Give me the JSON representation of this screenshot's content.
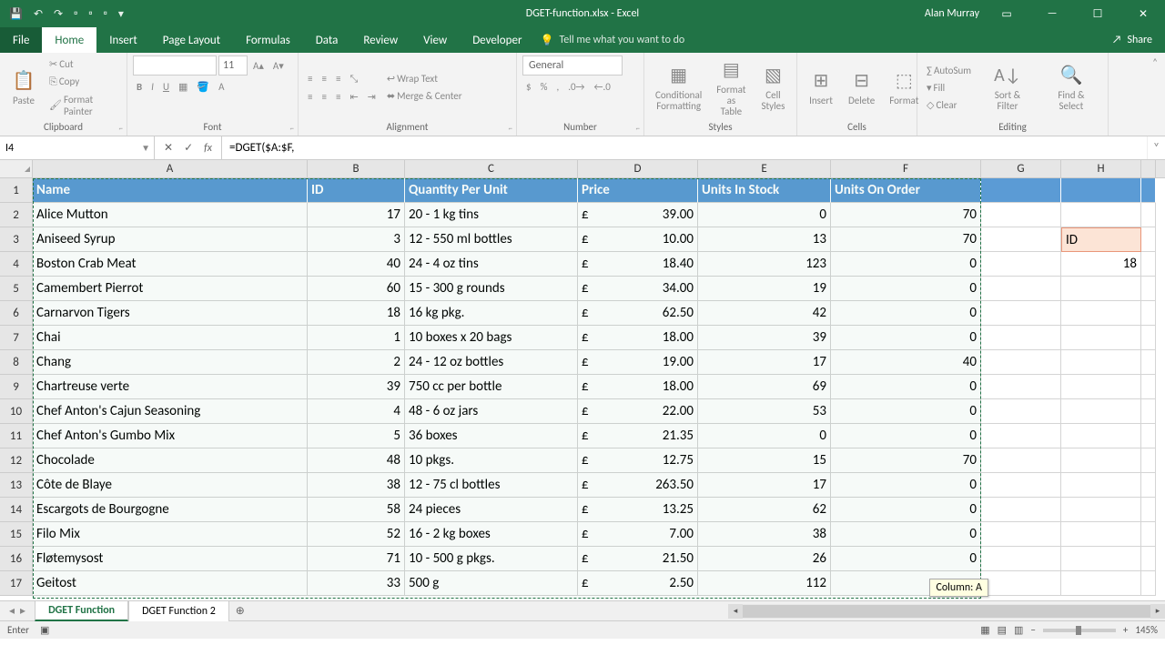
{
  "title": "DGET-function.xlsx - Excel",
  "user": "Alan Murray",
  "tabs": [
    "File",
    "Home",
    "Insert",
    "Page Layout",
    "Formulas",
    "Data",
    "Review",
    "View",
    "Developer"
  ],
  "active_tab": "Home",
  "tell_me": "Tell me what you want to do",
  "share": "Share",
  "ribbon": {
    "clipboard": {
      "label": "Clipboard",
      "paste": "Paste",
      "cut": "Cut",
      "copy": "Copy",
      "painter": "Format Painter"
    },
    "font": {
      "label": "Font",
      "size": "11"
    },
    "alignment": {
      "label": "Alignment",
      "wrap": "Wrap Text",
      "merge": "Merge & Center"
    },
    "number": {
      "label": "Number",
      "format": "General"
    },
    "styles": {
      "label": "Styles",
      "cond": "Conditional Formatting",
      "table": "Format as Table",
      "cell": "Cell Styles"
    },
    "cells": {
      "label": "Cells",
      "insert": "Insert",
      "delete": "Delete",
      "format": "Format"
    },
    "editing": {
      "label": "Editing",
      "sum": "AutoSum",
      "fill": "Fill",
      "clear": "Clear",
      "sort": "Sort & Filter",
      "find": "Find & Select"
    }
  },
  "name_box": "I4",
  "formula": "=DGET($A:$F,",
  "columns": [
    "A",
    "B",
    "C",
    "D",
    "E",
    "F",
    "G",
    "H"
  ],
  "headers": [
    "Name",
    "ID",
    "Quantity Per Unit",
    "Price",
    "Units In Stock",
    "Units On Order"
  ],
  "rows": [
    {
      "n": "Alice Mutton",
      "id": 17,
      "q": "20 - 1 kg tins",
      "p": "39.00",
      "s": 0,
      "o": 70
    },
    {
      "n": "Aniseed Syrup",
      "id": 3,
      "q": "12 - 550 ml bottles",
      "p": "10.00",
      "s": 13,
      "o": 70
    },
    {
      "n": "Boston Crab Meat",
      "id": 40,
      "q": "24 - 4 oz tins",
      "p": "18.40",
      "s": 123,
      "o": 0
    },
    {
      "n": "Camembert Pierrot",
      "id": 60,
      "q": "15 - 300 g rounds",
      "p": "34.00",
      "s": 19,
      "o": 0
    },
    {
      "n": "Carnarvon Tigers",
      "id": 18,
      "q": "16 kg pkg.",
      "p": "62.50",
      "s": 42,
      "o": 0
    },
    {
      "n": "Chai",
      "id": 1,
      "q": "10 boxes x 20 bags",
      "p": "18.00",
      "s": 39,
      "o": 0
    },
    {
      "n": "Chang",
      "id": 2,
      "q": "24 - 12 oz bottles",
      "p": "19.00",
      "s": 17,
      "o": 40
    },
    {
      "n": "Chartreuse verte",
      "id": 39,
      "q": "750 cc per bottle",
      "p": "18.00",
      "s": 69,
      "o": 0
    },
    {
      "n": "Chef Anton's Cajun Seasoning",
      "id": 4,
      "q": "48 - 6 oz jars",
      "p": "22.00",
      "s": 53,
      "o": 0
    },
    {
      "n": "Chef Anton's Gumbo Mix",
      "id": 5,
      "q": "36 boxes",
      "p": "21.35",
      "s": 0,
      "o": 0
    },
    {
      "n": "Chocolade",
      "id": 48,
      "q": "10 pkgs.",
      "p": "12.75",
      "s": 15,
      "o": 70
    },
    {
      "n": "Côte de Blaye",
      "id": 38,
      "q": "12 - 75 cl bottles",
      "p": "263.50",
      "s": 17,
      "o": 0
    },
    {
      "n": "Escargots de Bourgogne",
      "id": 58,
      "q": "24 pieces",
      "p": "13.25",
      "s": 62,
      "o": 0
    },
    {
      "n": "Filo Mix",
      "id": 52,
      "q": "16 - 2 kg boxes",
      "p": "7.00",
      "s": 38,
      "o": 0
    },
    {
      "n": "Fløtemysost",
      "id": 71,
      "q": "10 - 500 g pkgs.",
      "p": "21.50",
      "s": 26,
      "o": 0
    },
    {
      "n": "Geitost",
      "id": 33,
      "q": "500 g",
      "p": "2.50",
      "s": 112,
      "o": ""
    }
  ],
  "side": {
    "header": "ID",
    "value": "18"
  },
  "tooltip": "Column: A",
  "sheet_tabs": [
    "DGET Function",
    "DGET Function 2"
  ],
  "active_sheet": 0,
  "status": {
    "mode": "Enter",
    "zoom": "145%"
  }
}
